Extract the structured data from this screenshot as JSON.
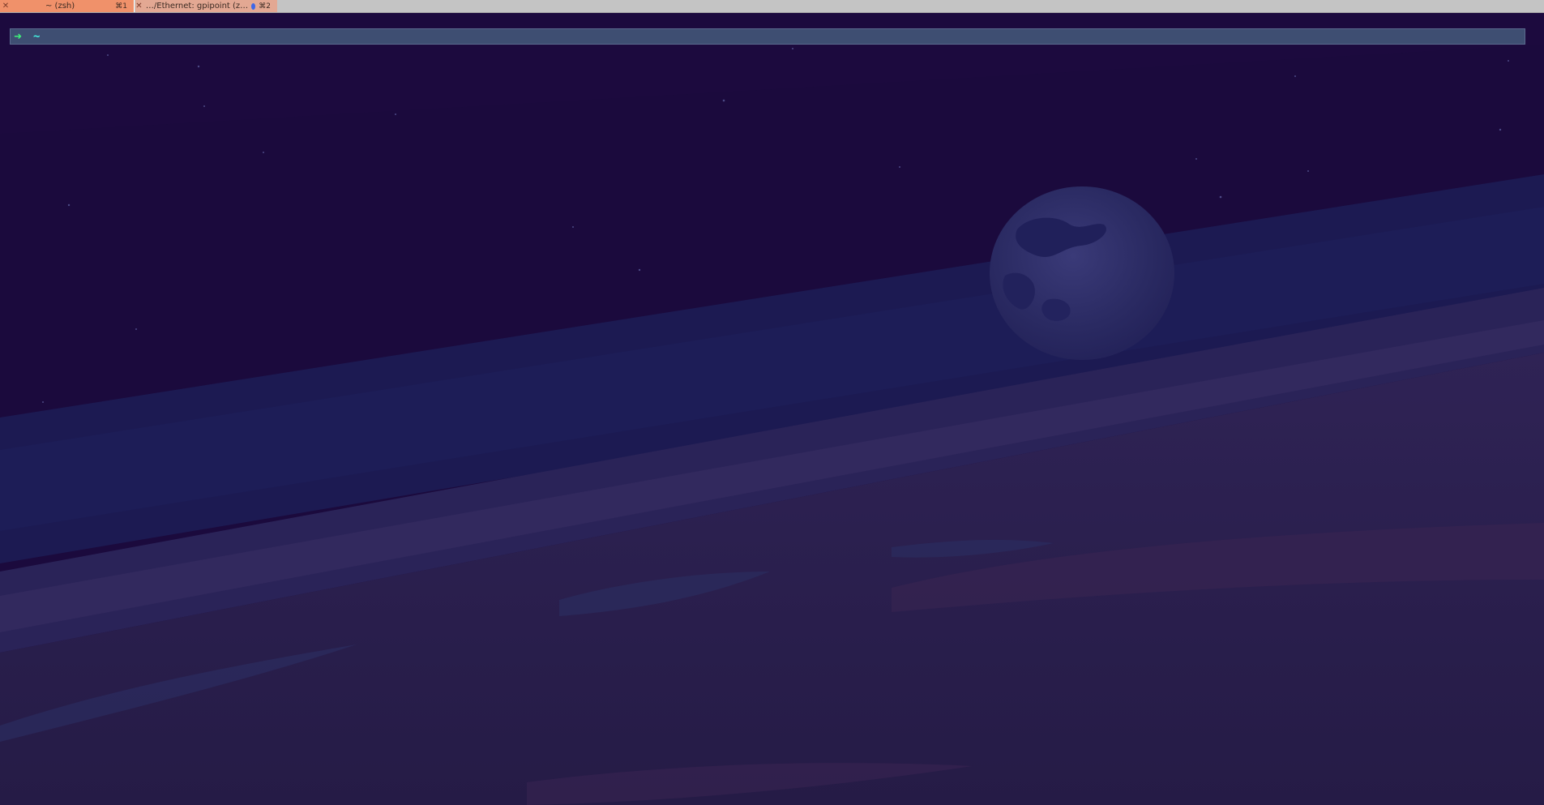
{
  "tabs": [
    {
      "title": "~ (zsh)",
      "shortcut": "⌘1",
      "active": true
    },
    {
      "title": "…/Ethernet: gpipoint (z…",
      "shortcut": "⌘2",
      "active": false
    }
  ],
  "prompt": {
    "arrow": "➜",
    "cwd": "~",
    "input_value": ""
  },
  "colors": {
    "active_tab": "#f0916a",
    "inactive_tab": "#e3a893",
    "tabbar": "#c4c4c4",
    "prompt_bg": "#3e4e72",
    "prompt_arrow": "#3ff17a",
    "prompt_cwd": "#43f0e0",
    "sky": "#1b0a3d"
  },
  "icons": {
    "tab_close": "close-icon",
    "activity_dot": "activity-dot-icon",
    "prompt_arrow": "arrow-right-icon"
  }
}
